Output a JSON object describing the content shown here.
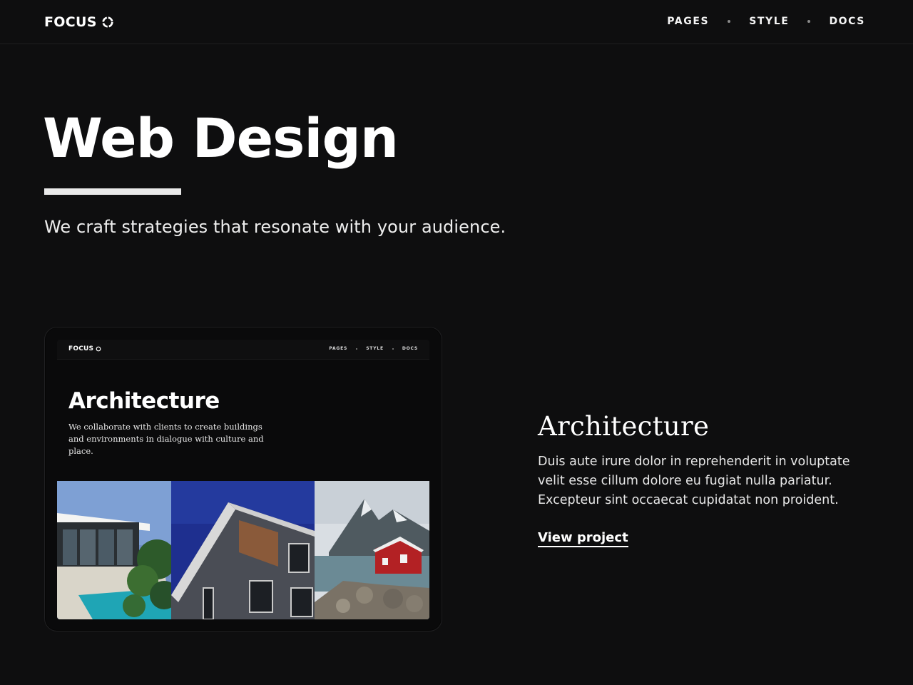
{
  "brand": {
    "name": "FOCUS",
    "icon": "ring-icon"
  },
  "nav": {
    "items": [
      {
        "label": "PAGES"
      },
      {
        "label": "STYLE"
      },
      {
        "label": "DOCS"
      }
    ]
  },
  "hero": {
    "title": "Web Design",
    "subtitle": "We craft strategies that resonate with your audience."
  },
  "project": {
    "preview": {
      "brand": "FOCUS",
      "nav": [
        "PAGES",
        "STYLE",
        "DOCS"
      ],
      "title": "Architecture",
      "text": "We collaborate with clients to create buildings and environments in dialogue with culture and place.",
      "images": [
        "modern-house-with-pool",
        "brick-building-facade",
        "red-cabin-by-fjord"
      ]
    },
    "title": "Architecture",
    "description": "Duis aute irure dolor in reprehenderit in voluptate velit esse cillum dolore eu fugiat nulla pariatur. Excepteur sint occaecat cupidatat non proident.",
    "link_label": "View project"
  },
  "colors": {
    "background": "#0e0e0f",
    "text": "#ffffff",
    "accent_rule": "#e9e9e9"
  }
}
